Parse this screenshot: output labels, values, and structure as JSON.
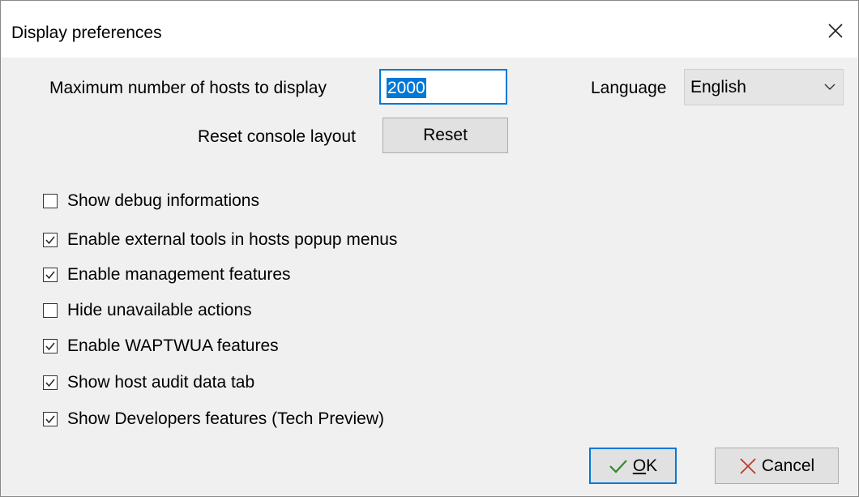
{
  "window": {
    "title": "Display preferences"
  },
  "settings": {
    "max_hosts_label": "Maximum number of hosts to display",
    "max_hosts_value": "2000",
    "language_label": "Language",
    "language_value": "English",
    "reset_layout_label": "Reset console layout",
    "reset_button_label": "Reset"
  },
  "options": [
    {
      "label": "Show debug informations",
      "checked": false
    },
    {
      "label": "Enable external tools in hosts popup menus",
      "checked": true
    },
    {
      "label": "Enable management features",
      "checked": true
    },
    {
      "label": "Hide unavailable actions",
      "checked": false
    },
    {
      "label": "Enable WAPTWUA features",
      "checked": true
    },
    {
      "label": "Show host audit data tab",
      "checked": true
    },
    {
      "label": "Show Developers features (Tech Preview)",
      "checked": true
    }
  ],
  "buttons": {
    "ok_mnemonic": "O",
    "ok_rest": "K",
    "cancel_label": "Cancel"
  },
  "icons": {
    "close": "close-icon",
    "dropdown": "chevron-down-icon",
    "ok": "checkmark-icon",
    "cancel": "x-cross-icon"
  },
  "colors": {
    "accent": "#0078d7",
    "ok_check": "#2e8b2e",
    "cancel_cross": "#c0392b"
  }
}
